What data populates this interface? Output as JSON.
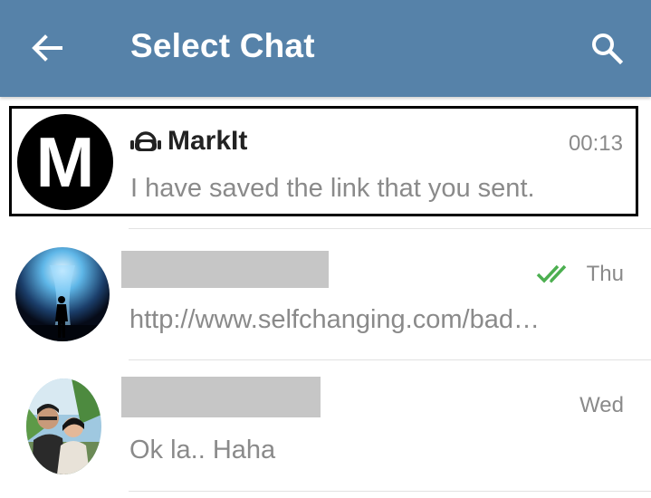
{
  "header": {
    "title": "Select Chat",
    "back_icon": "arrow-left-icon",
    "search_icon": "search-icon",
    "background_color": "#5682a9"
  },
  "chats": [
    {
      "avatar_letter": "M",
      "bot_icon": "bot-icon",
      "name": "MarkIt",
      "time": "00:13",
      "message": "I have saved the link that you sent.",
      "selected": true
    },
    {
      "avatar": "photo-waterfall-silhouette",
      "name_redacted": true,
      "status_icon": "double-check-icon",
      "status_color": "#4caf50",
      "time": "Thu",
      "message": "http://www.selfchanging.com/bad…"
    },
    {
      "avatar": "photo-couple-selfie",
      "name_redacted": true,
      "time": "Wed",
      "message": "Ok la.. Haha"
    }
  ]
}
